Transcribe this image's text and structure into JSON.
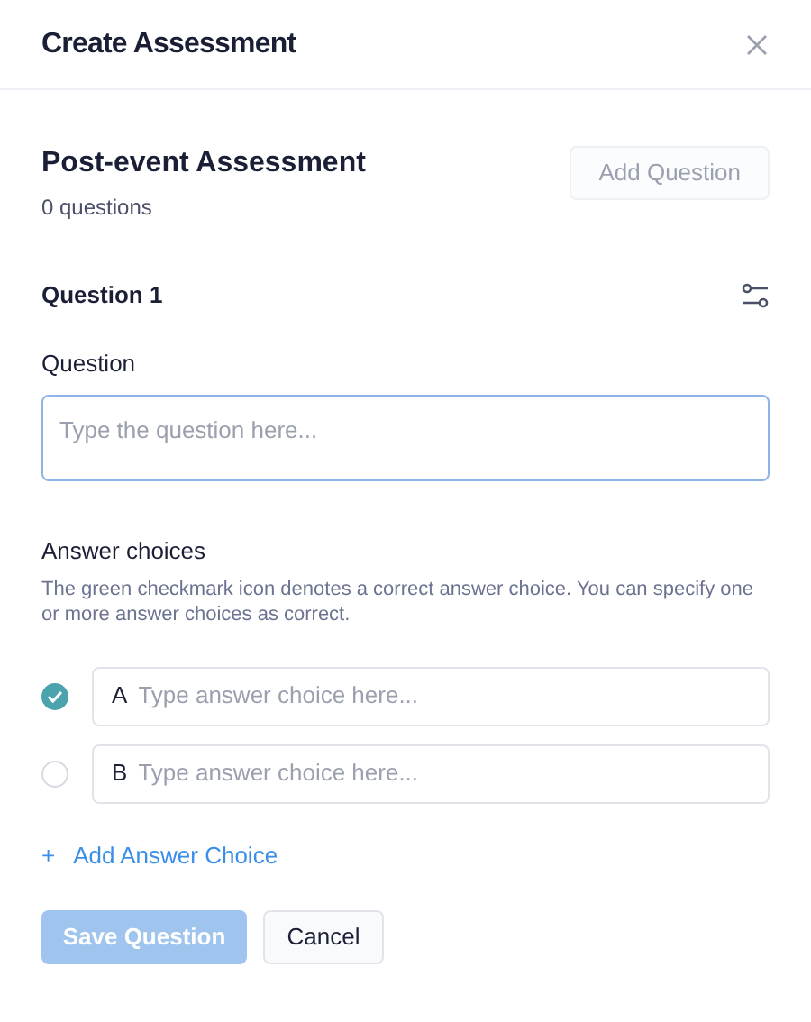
{
  "dialog": {
    "title": "Create Assessment"
  },
  "assessment": {
    "title": "Post-event Assessment",
    "count": "0 questions",
    "add_question": {
      "label": "Add Question",
      "disabled": true
    }
  },
  "question": {
    "heading": "Question 1",
    "label": "Question",
    "placeholder": "Type the question here..."
  },
  "answers": {
    "label": "Answer choices",
    "description": "The green checkmark icon denotes a correct answer choice. You can specify one or more answer choices as correct.",
    "choices": [
      {
        "letter": "A",
        "placeholder": "Type answer choice here...",
        "checked": true
      },
      {
        "letter": "B",
        "placeholder": "Type answer choice here...",
        "checked": false
      }
    ],
    "add": {
      "icon": "+",
      "label": "Add Answer Choice"
    }
  },
  "buttons": [
    {
      "label": "Save Question",
      "kind": "primary",
      "disabled": true
    },
    {
      "label": "Cancel",
      "kind": "secondary",
      "disabled": false
    }
  ]
}
